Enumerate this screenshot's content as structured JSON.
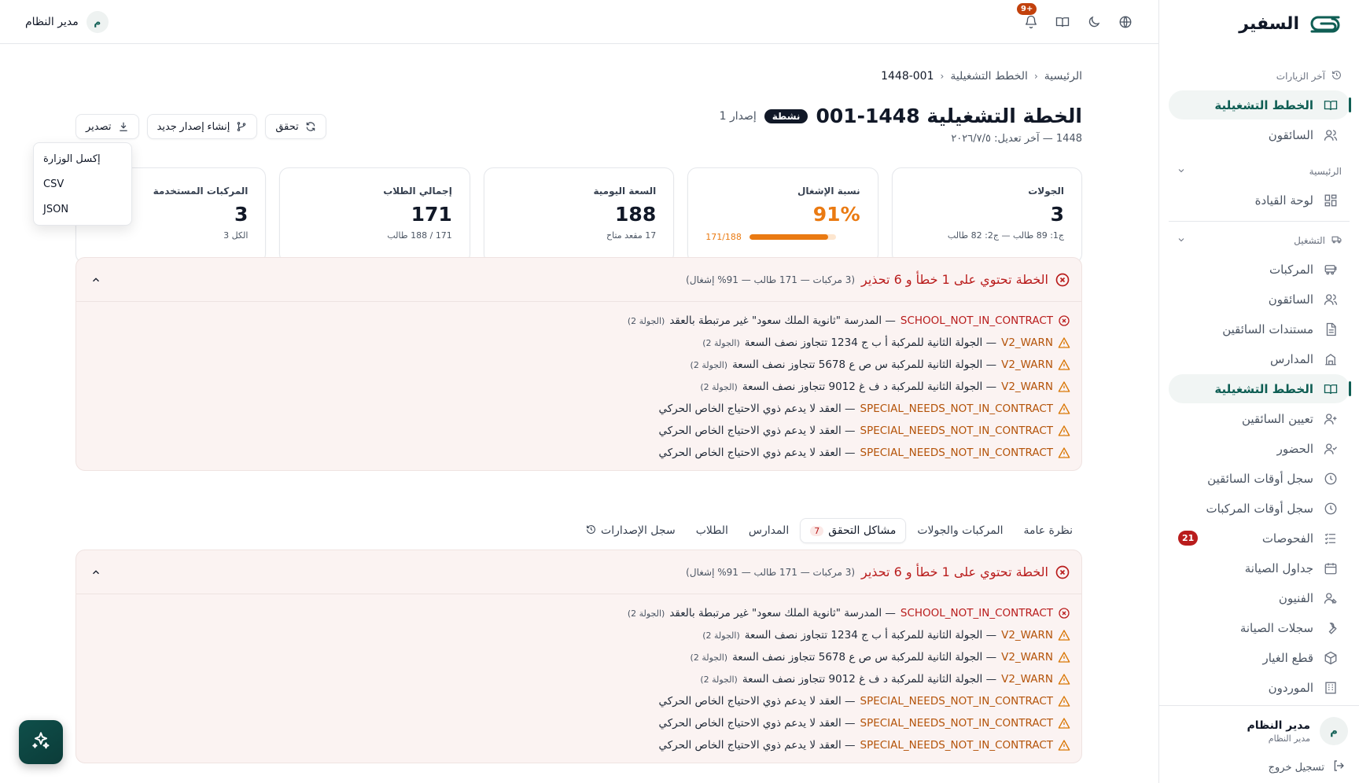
{
  "brand": {
    "name": "السفير"
  },
  "topbar": {
    "notifications_badge": "+9",
    "user_initial": "م",
    "user_name": "مدير النظام"
  },
  "sidebar": {
    "recent_label": "آخر الزيارات",
    "recent_items": [
      {
        "label": "الخطط التشغيلية",
        "icon": "book-icon",
        "active": true
      },
      {
        "label": "السائقون",
        "icon": "users-icon",
        "active": false
      }
    ],
    "group_main": {
      "label": "الرئيسية",
      "items": [
        {
          "label": "لوحة القيادة",
          "icon": "dashboard-icon"
        }
      ]
    },
    "group_ops": {
      "label": "التشغيل",
      "items": [
        {
          "label": "المركبات",
          "icon": "bus-icon"
        },
        {
          "label": "السائقون",
          "icon": "users-icon"
        },
        {
          "label": "مستندات السائقين",
          "icon": "document-icon"
        },
        {
          "label": "المدارس",
          "icon": "school-icon"
        },
        {
          "label": "الخطط التشغيلية",
          "icon": "book-icon"
        },
        {
          "label": "تعيين السائقين",
          "icon": "user-assign-icon"
        },
        {
          "label": "الحضور",
          "icon": "user-check-icon"
        },
        {
          "label": "سجل أوقات السائقين",
          "icon": "clock-icon"
        },
        {
          "label": "سجل أوقات المركبات",
          "icon": "clock-icon"
        },
        {
          "label": "الفحوصات",
          "icon": "checklist-icon",
          "badge": "21"
        },
        {
          "label": "جداول الصيانة",
          "icon": "calendar-icon"
        },
        {
          "label": "الفنيون",
          "icon": "technician-icon"
        },
        {
          "label": "سجلات الصيانة",
          "icon": "wrench-icon"
        },
        {
          "label": "قطع الغيار",
          "icon": "box-icon"
        },
        {
          "label": "الموردون",
          "icon": "building-icon"
        }
      ]
    },
    "footer": {
      "user_initial": "م",
      "user_name": "مدير النظام",
      "user_role": "مدير النظام",
      "logout": "تسجيل خروج"
    }
  },
  "breadcrumb": {
    "home": "الرئيسية",
    "section": "الخطط التشغيلية",
    "current": "1448-001"
  },
  "page": {
    "title": "الخطة التشغيلية 1448-001",
    "status": "نشطة",
    "version": "إصدار 1",
    "subtitle": "1448 — آخر تعديل: ٢٠٢٦/٧/٥"
  },
  "actions": {
    "verify": "تحقق",
    "new_version": "إنشاء إصدار جديد",
    "export": "تصدير"
  },
  "export_menu": [
    "إكسل الوزارة",
    "CSV",
    "JSON"
  ],
  "stats": [
    {
      "label": "المركبات المستخدمة",
      "value": "3",
      "sub": "الكل 3"
    },
    {
      "label": "إجمالي الطلاب",
      "value": "171",
      "sub": "171 / 188 طالب"
    },
    {
      "label": "السعة اليومية",
      "value": "188",
      "sub": "17 مقعد متاح"
    },
    {
      "label": "نسبة الإشغال",
      "value": "91%",
      "progress_text": "171/188",
      "progress": 0.91
    },
    {
      "label": "الجولات",
      "value": "3",
      "sub": "ج1: 89 طالب — ج2: 82 طالب"
    }
  ],
  "validation": {
    "title": "الخطة تحتوي على 1 خطأ و 6 تحذير",
    "meta": "(3 مركبات — 171 طالب — 91% إشغال)",
    "issues": [
      {
        "level": "error",
        "code": "SCHOOL_NOT_IN_CONTRACT",
        "message": "— المدرسة \"ثانوية الملك سعود\" غير مرتبطة بالعقد",
        "note": "(الجولة 2)"
      },
      {
        "level": "warn",
        "code": "V2_WARN",
        "message": "— الجولة الثانية للمركبة أ ب ج 1234 تتجاوز نصف السعة",
        "note": "(الجولة 2)"
      },
      {
        "level": "warn",
        "code": "V2_WARN",
        "message": "— الجولة الثانية للمركبة س ص ع 5678 تتجاوز نصف السعة",
        "note": "(الجولة 2)"
      },
      {
        "level": "warn",
        "code": "V2_WARN",
        "message": "— الجولة الثانية للمركبة د ف غ 9012 تتجاوز نصف السعة",
        "note": "(الجولة 2)"
      },
      {
        "level": "warn",
        "code": "SPECIAL_NEEDS_NOT_IN_CONTRACT",
        "message": "— العقد لا يدعم ذوي الاحتياج الخاص الحركي",
        "note": ""
      },
      {
        "level": "warn",
        "code": "SPECIAL_NEEDS_NOT_IN_CONTRACT",
        "message": "— العقد لا يدعم ذوي الاحتياج الخاص الحركي",
        "note": ""
      },
      {
        "level": "warn",
        "code": "SPECIAL_NEEDS_NOT_IN_CONTRACT",
        "message": "— العقد لا يدعم ذوي الاحتياج الخاص الحركي",
        "note": ""
      }
    ]
  },
  "tabs": [
    {
      "label": "نظرة عامة",
      "active": false
    },
    {
      "label": "المركبات والجولات",
      "active": false
    },
    {
      "label": "مشاكل التحقق",
      "active": true,
      "count": "7"
    },
    {
      "label": "المدارس",
      "active": false
    },
    {
      "label": "الطلاب",
      "active": false
    },
    {
      "label": "سجل الإصدارات",
      "active": false,
      "icon": "history-icon"
    }
  ],
  "colors": {
    "brand": "#0f5e54",
    "error": "#b91c1c",
    "warning": "#b45309",
    "occupancy": "#ea7a12"
  }
}
